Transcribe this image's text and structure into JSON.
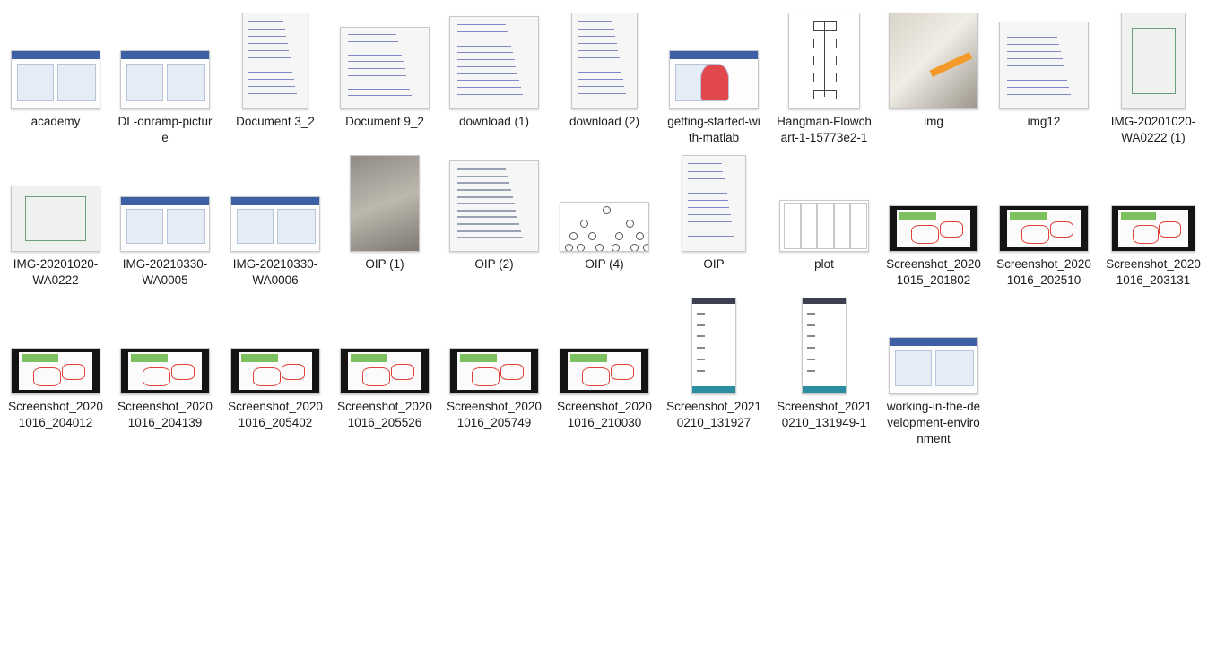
{
  "files": [
    {
      "name": "academy",
      "icon": "ui-screenshot-thumbnail"
    },
    {
      "name": "DL-onramp-picture",
      "icon": "ui-screenshot-thumbnail"
    },
    {
      "name": "Document 3_2",
      "icon": "handwritten-page-thumbnail"
    },
    {
      "name": "Document 9_2",
      "icon": "handwritten-page-thumbnail"
    },
    {
      "name": "download (1)",
      "icon": "handwritten-page-thumbnail"
    },
    {
      "name": "download (2)",
      "icon": "handwritten-page-thumbnail"
    },
    {
      "name": "getting-started-with-matlab",
      "icon": "ui-screenshot-thumbnail"
    },
    {
      "name": "Hangman-Flowchart-1-15773e2-1",
      "icon": "flowchart-thumbnail"
    },
    {
      "name": "img",
      "icon": "photo-thumbnail"
    },
    {
      "name": "img12",
      "icon": "handwritten-page-thumbnail"
    },
    {
      "name": "IMG-20201020-WA0222 (1)",
      "icon": "photo-thumbnail"
    },
    {
      "name": "IMG-20201020-WA0222",
      "icon": "photo-thumbnail"
    },
    {
      "name": "IMG-20210330-WA0005",
      "icon": "ui-screenshot-thumbnail"
    },
    {
      "name": "IMG-20210330-WA0006",
      "icon": "ui-screenshot-thumbnail"
    },
    {
      "name": "OIP (1)",
      "icon": "photo-thumbnail"
    },
    {
      "name": "OIP (2)",
      "icon": "document-thumbnail"
    },
    {
      "name": "OIP (4)",
      "icon": "tree-diagram-thumbnail"
    },
    {
      "name": "OIP",
      "icon": "handwritten-page-thumbnail"
    },
    {
      "name": "plot",
      "icon": "grid-thumbnail"
    },
    {
      "name": "Screenshot_20201015_201802",
      "icon": "slide-thumbnail"
    },
    {
      "name": "Screenshot_20201016_202510",
      "icon": "slide-thumbnail"
    },
    {
      "name": "Screenshot_20201016_203131",
      "icon": "slide-thumbnail"
    },
    {
      "name": "Screenshot_20201016_204012",
      "icon": "slide-thumbnail"
    },
    {
      "name": "Screenshot_20201016_204139",
      "icon": "slide-thumbnail"
    },
    {
      "name": "Screenshot_20201016_205402",
      "icon": "slide-thumbnail"
    },
    {
      "name": "Screenshot_20201016_205526",
      "icon": "slide-thumbnail"
    },
    {
      "name": "Screenshot_20201016_205749",
      "icon": "slide-thumbnail"
    },
    {
      "name": "Screenshot_20201016_210030",
      "icon": "slide-thumbnail"
    },
    {
      "name": "Screenshot_20210210_131927",
      "icon": "phone-screenshot-thumbnail"
    },
    {
      "name": "Screenshot_20210210_131949-1",
      "icon": "phone-screenshot-thumbnail"
    },
    {
      "name": "working-in-the-development-environment",
      "icon": "ui-screenshot-thumbnail"
    }
  ]
}
